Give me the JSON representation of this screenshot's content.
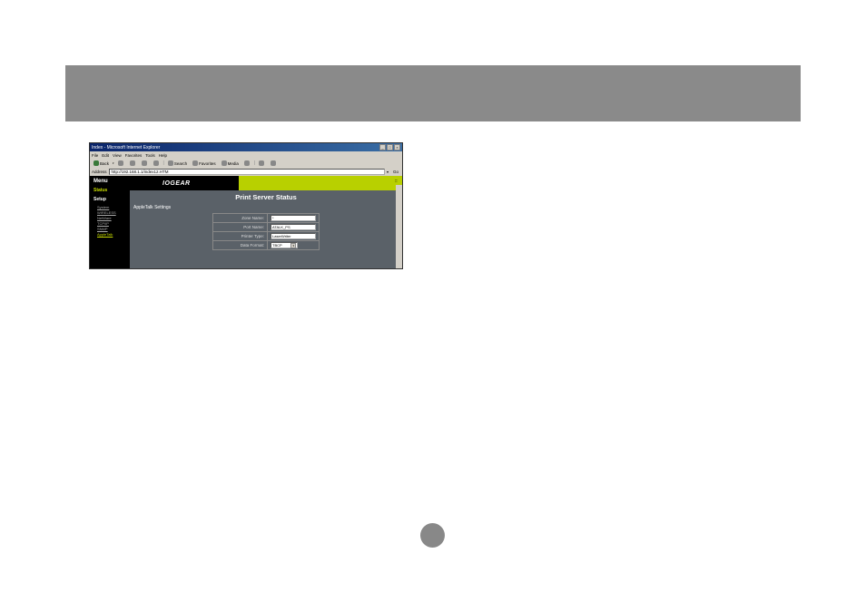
{
  "window": {
    "title": "Index - Microsoft Internet Explorer"
  },
  "menubar": {
    "items": [
      "File",
      "Edit",
      "View",
      "Favorites",
      "Tools",
      "Help"
    ]
  },
  "toolbar": {
    "back": "Back",
    "search": "Search",
    "favorites": "Favorites",
    "media": "Media"
  },
  "addressbar": {
    "label": "Address",
    "url": "http://192.168.1.1/index12.HTM",
    "go": "Go"
  },
  "sidebar": {
    "menu_title": "Menu",
    "status": "Status",
    "setup": "Setup",
    "items": [
      {
        "label": "System",
        "active": false
      },
      {
        "label": "WIRELESS",
        "active": false
      },
      {
        "label": "NetWare",
        "active": false
      },
      {
        "label": "TCP/IP",
        "active": false
      },
      {
        "label": "SNMP",
        "active": false
      },
      {
        "label": "AppleTalk",
        "active": true
      }
    ]
  },
  "main": {
    "logo": "IOGEAR",
    "heading": "Print Server Status",
    "section": "AppleTalk Settings",
    "rows": [
      {
        "label": "Zone Name:",
        "value": "*",
        "type": "text"
      },
      {
        "label": "Port Name:",
        "value": "ATALK_PS",
        "type": "text"
      },
      {
        "label": "Printer Type:",
        "value": "LaserWriter",
        "type": "text"
      },
      {
        "label": "Data Format:",
        "value": "TBCP",
        "type": "select"
      }
    ]
  }
}
